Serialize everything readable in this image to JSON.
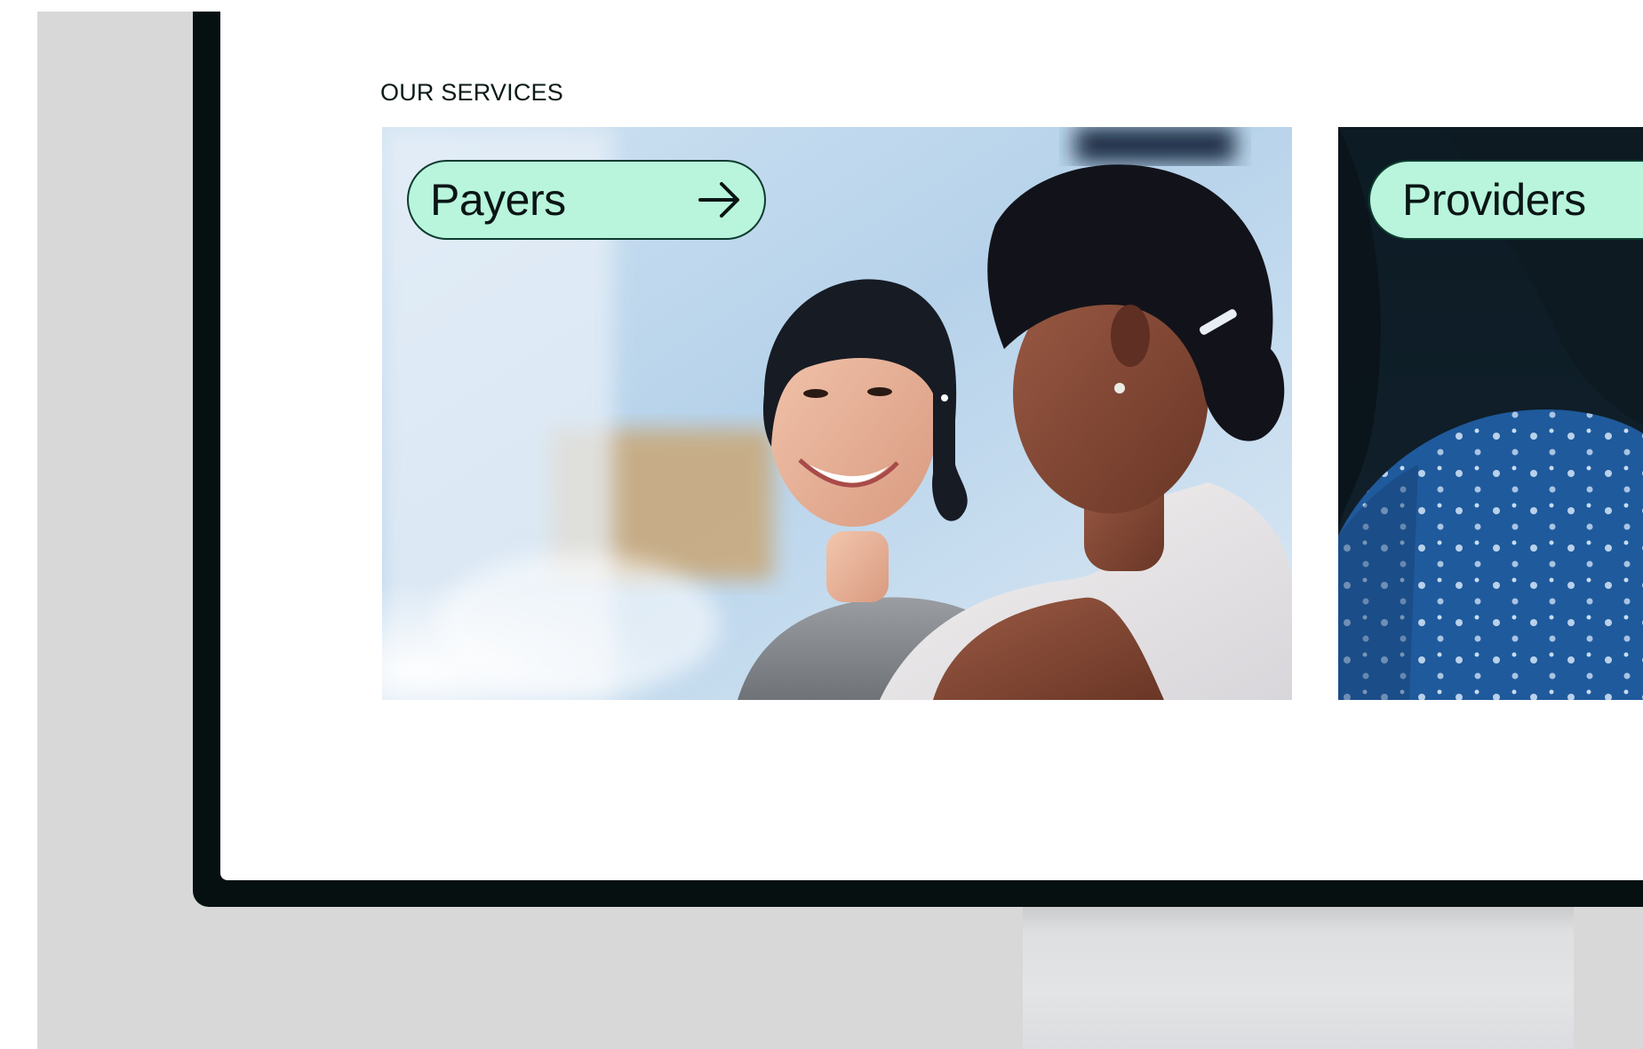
{
  "section": {
    "label": "OUR SERVICES"
  },
  "cards": [
    {
      "label": "Payers",
      "icon": "arrow-right-icon"
    },
    {
      "label": "Providers"
    }
  ],
  "colors": {
    "pill_background": "#b8f5dc",
    "pill_border": "#0d3b2e",
    "monitor_bezel": "#061010",
    "backdrop": "#d8d8d9"
  }
}
